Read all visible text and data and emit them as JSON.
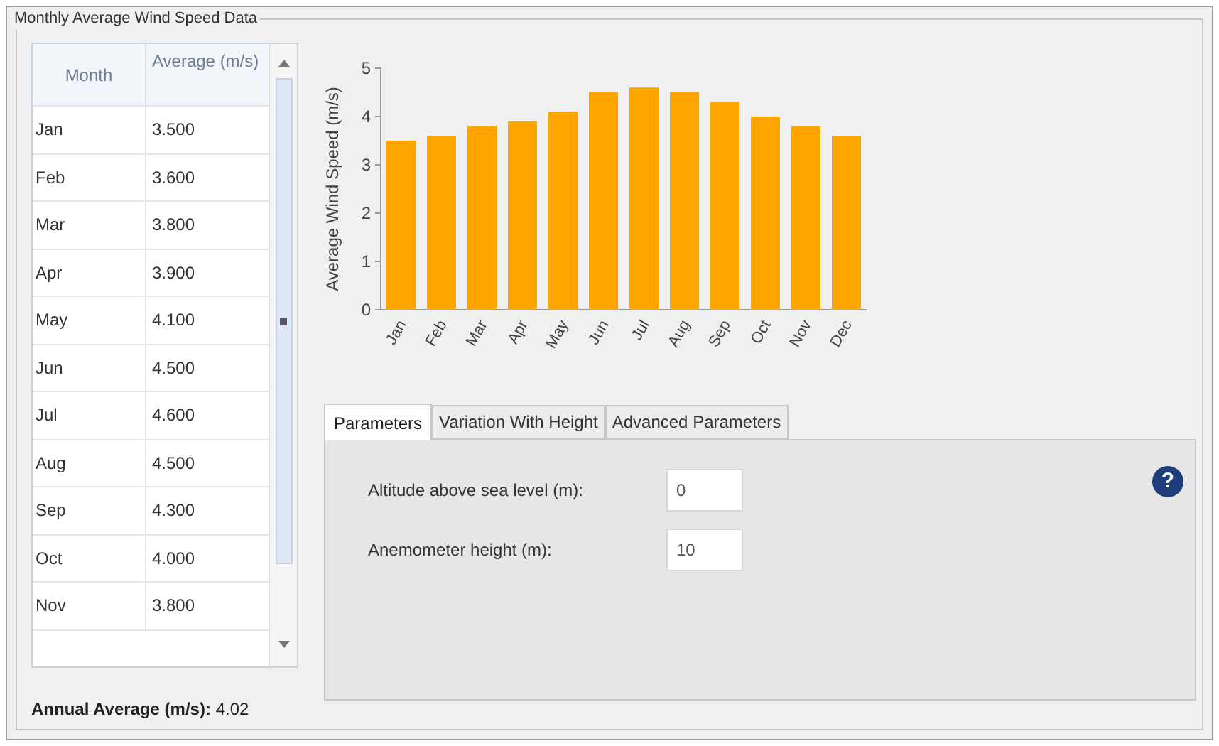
{
  "group_title": "Monthly Average Wind Speed Data",
  "table": {
    "columns": [
      "Month",
      "Average (m/s)"
    ],
    "rows": [
      [
        "Jan",
        "3.500"
      ],
      [
        "Feb",
        "3.600"
      ],
      [
        "Mar",
        "3.800"
      ],
      [
        "Apr",
        "3.900"
      ],
      [
        "May",
        "4.100"
      ],
      [
        "Jun",
        "4.500"
      ],
      [
        "Jul",
        "4.600"
      ],
      [
        "Aug",
        "4.500"
      ],
      [
        "Sep",
        "4.300"
      ],
      [
        "Oct",
        "4.000"
      ],
      [
        "Nov",
        "3.800"
      ]
    ]
  },
  "annual_average": {
    "label": "Annual Average (m/s):",
    "value": "4.02"
  },
  "chart_data": {
    "type": "bar",
    "ylabel": "Average Wind Speed (m/s)",
    "categories": [
      "Jan",
      "Feb",
      "Mar",
      "Apr",
      "May",
      "Jun",
      "Jul",
      "Aug",
      "Sep",
      "Oct",
      "Nov",
      "Dec"
    ],
    "series": [
      {
        "color": "#ffa500",
        "values": [
          3.5,
          3.6,
          3.8,
          3.9,
          4.1,
          4.5,
          4.6,
          4.5,
          4.3,
          4.0,
          3.8,
          3.6
        ]
      }
    ],
    "ylim": [
      0,
      5
    ],
    "yticks": [
      0,
      1,
      2,
      3,
      4,
      5
    ]
  },
  "tabs": [
    {
      "label": "Parameters",
      "selected": true
    },
    {
      "label": "Variation With Height",
      "selected": false
    },
    {
      "label": "Advanced Parameters",
      "selected": false
    }
  ],
  "fields": [
    {
      "label": "Altitude above sea level (m):",
      "value": "0"
    },
    {
      "label": "Anemometer height (m):",
      "value": "10"
    }
  ],
  "help": "?"
}
